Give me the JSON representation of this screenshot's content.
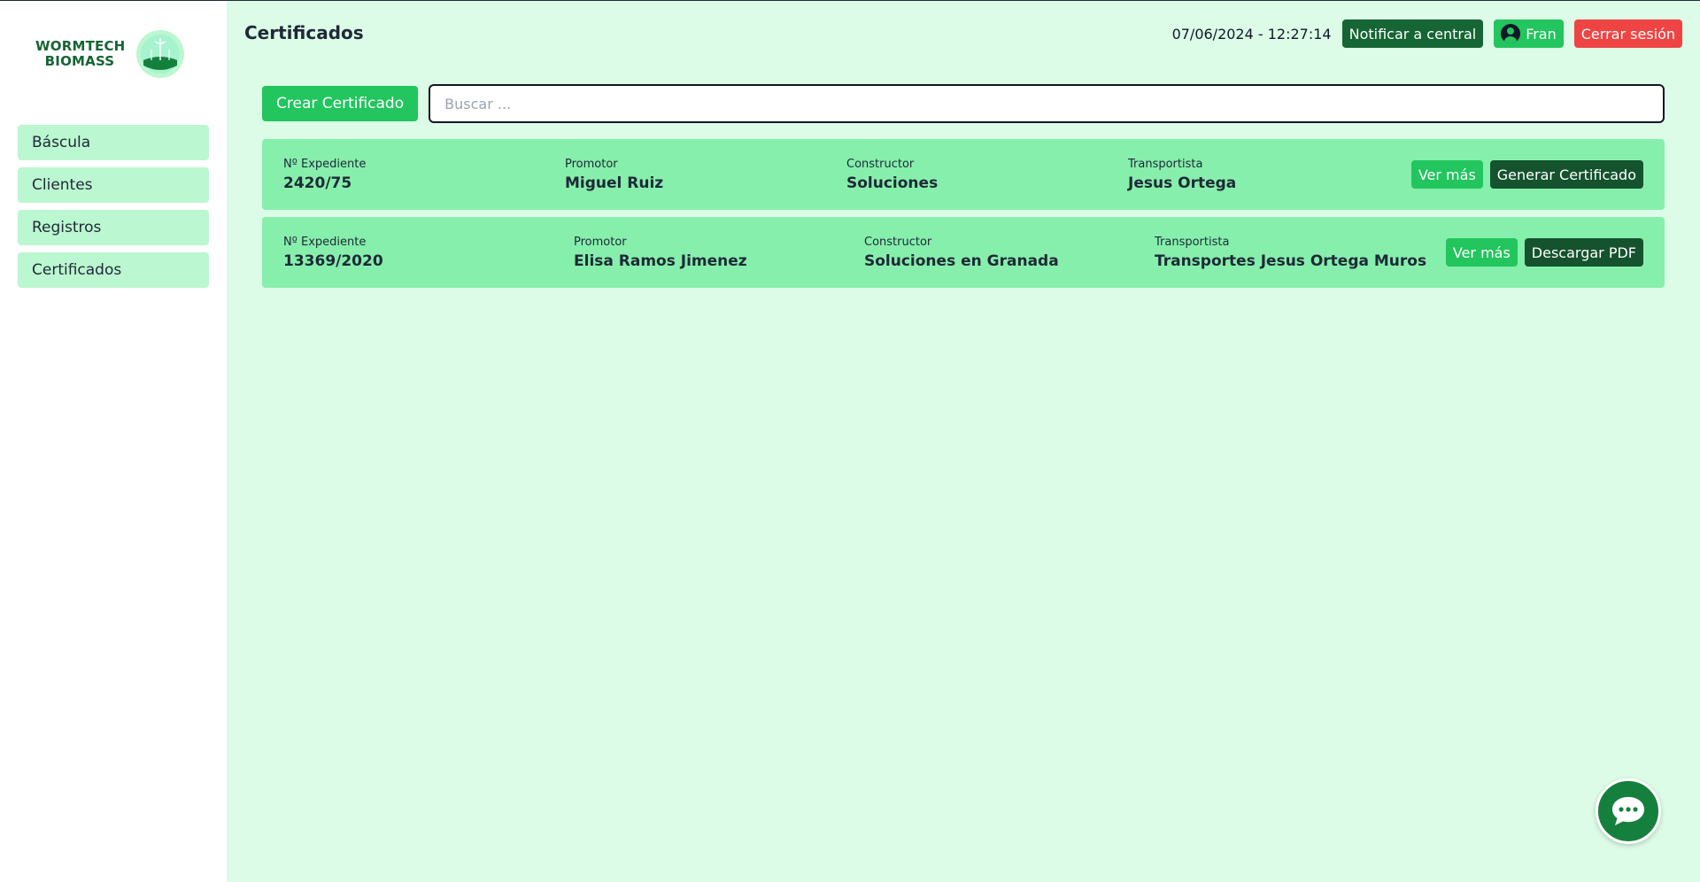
{
  "brand": {
    "line1": "WORMTECH",
    "line2": "BIOMASS"
  },
  "sidebar": {
    "items": [
      {
        "label": "Báscula"
      },
      {
        "label": "Clientes"
      },
      {
        "label": "Registros"
      },
      {
        "label": "Certificados"
      }
    ]
  },
  "header": {
    "title": "Certificados",
    "datetime": "07/06/2024 - 12:27:14",
    "notify_label": "Notificar a central",
    "user_label": "Fran",
    "logout_label": "Cerrar sesión"
  },
  "toolbar": {
    "create_label": "Crear Certificado",
    "search_placeholder": "Buscar ..."
  },
  "certificates": [
    {
      "expediente_label": "Nº Expediente",
      "expediente": "2420/75",
      "promotor_label": "Promotor",
      "promotor": "Miguel Ruiz",
      "constructor_label": "Constructor",
      "constructor": "Soluciones",
      "transportista_label": "Transportista",
      "transportista": "Jesus Ortega",
      "more_label": "Ver más",
      "action_label": "Generar Certificado"
    },
    {
      "expediente_label": "Nº Expediente",
      "expediente": "13369/2020",
      "promotor_label": "Promotor",
      "promotor": "Elisa Ramos Jimenez",
      "constructor_label": "Constructor",
      "constructor": "Soluciones en Granada",
      "transportista_label": "Transportista",
      "transportista": "Transportes Jesus Ortega Muros",
      "more_label": "Ver más",
      "action_label": "Descargar PDF"
    }
  ],
  "icons": {
    "user": "user-circle-icon",
    "chat": "chat-bubble-icon",
    "logo": "wind-turbine-logo-icon"
  },
  "colors": {
    "background": "#dcfce7",
    "card": "#86efac",
    "accent": "#22c55e",
    "danger": "#ef4444",
    "dark": "#166534"
  }
}
